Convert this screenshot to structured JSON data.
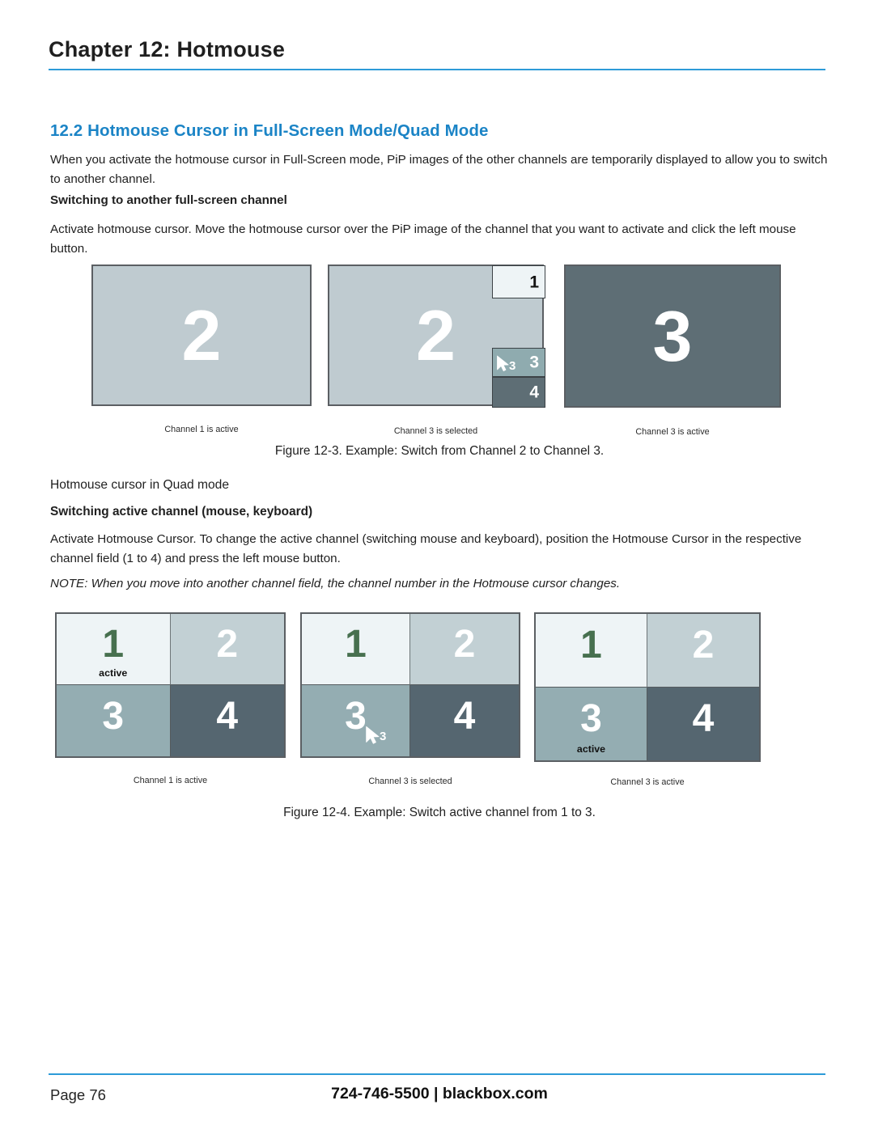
{
  "header": {
    "chapter_title": "Chapter 12: Hotmouse",
    "rule_color": "#2d9bd8"
  },
  "section": {
    "heading": "12.2 Hotmouse Cursor in Full-Screen Mode/Quad Mode",
    "heading_color": "#1b84c6",
    "intro_paragraph": "When you activate the hotmouse cursor in Full-Screen mode, PiP images of the other channels are temporarily displayed to allow you to switch to another channel.",
    "subheading_1": "Switching to another full-screen channel",
    "paragraph_1": "Activate hotmouse cursor. Move the hotmouse cursor over the PiP image of the channel that you want to activate and click the left mouse button.",
    "subheading_2": "Hotmouse cursor in Quad mode",
    "subheading_3": "Switching active channel (mouse, keyboard)",
    "paragraph_2": "Activate Hotmouse Cursor. To change the active channel (switching mouse and keyboard), position the Hotmouse Cursor in the respective channel field (1 to 4) and press the left mouse button.",
    "note": "NOTE: When you move into another channel field, the channel number in the Hotmouse cursor changes."
  },
  "figure_12_3": {
    "caption": "Figure 12-3. Example: Switch from Channel 2 to Channel 3.",
    "panels": [
      {
        "big_number": "2",
        "label": "Channel 1 is active",
        "background": "#bfcbd0"
      },
      {
        "big_number": "2",
        "label": "Channel 3 is selected",
        "background": "#bfcbd0",
        "pips": [
          {
            "number": "1",
            "background": "#eef4f6",
            "text_color": "#131313"
          },
          {
            "number": "3",
            "background": "#8fabaf",
            "text_color": "#ffffff",
            "cursor_number": "3"
          },
          {
            "number": "4",
            "background": "#5e6e75",
            "text_color": "#ffffff"
          }
        ]
      },
      {
        "big_number": "3",
        "label": "Channel 3 is active",
        "background": "#5e6e75"
      }
    ]
  },
  "figure_12_4": {
    "caption": "Figure 12-4. Example: Switch active channel from 1 to 3.",
    "panels": [
      {
        "label": "Channel 1 is active",
        "cells": [
          {
            "number": "1",
            "background": "#eef4f6",
            "number_color": "#47704f",
            "active_label": "active"
          },
          {
            "number": "2",
            "background": "#c2d0d4",
            "number_color": "#ffffff",
            "active_label": ""
          },
          {
            "number": "3",
            "background": "#94adb2",
            "number_color": "#ffffff",
            "active_label": ""
          },
          {
            "number": "4",
            "background": "#556670",
            "number_color": "#ffffff",
            "active_label": ""
          }
        ]
      },
      {
        "label": "Channel 3 is selected",
        "cells": [
          {
            "number": "1",
            "background": "#eef4f6",
            "number_color": "#47704f",
            "active_label": ""
          },
          {
            "number": "2",
            "background": "#c2d0d4",
            "number_color": "#ffffff",
            "active_label": ""
          },
          {
            "number": "3",
            "background": "#94adb2",
            "number_color": "#ffffff",
            "active_label": "",
            "cursor_number": "3"
          },
          {
            "number": "4",
            "background": "#556670",
            "number_color": "#ffffff",
            "active_label": ""
          }
        ]
      },
      {
        "label": "Channel 3 is active",
        "cells": [
          {
            "number": "1",
            "background": "#eef4f6",
            "number_color": "#47704f",
            "active_label": ""
          },
          {
            "number": "2",
            "background": "#c2d0d4",
            "number_color": "#ffffff",
            "active_label": ""
          },
          {
            "number": "3",
            "background": "#94adb2",
            "number_color": "#ffffff",
            "active_label": "active"
          },
          {
            "number": "4",
            "background": "#556670",
            "number_color": "#ffffff",
            "active_label": ""
          }
        ]
      }
    ]
  },
  "footer": {
    "page_label": "Page 76",
    "contact": "724-746-5500  |   blackbox.com"
  }
}
